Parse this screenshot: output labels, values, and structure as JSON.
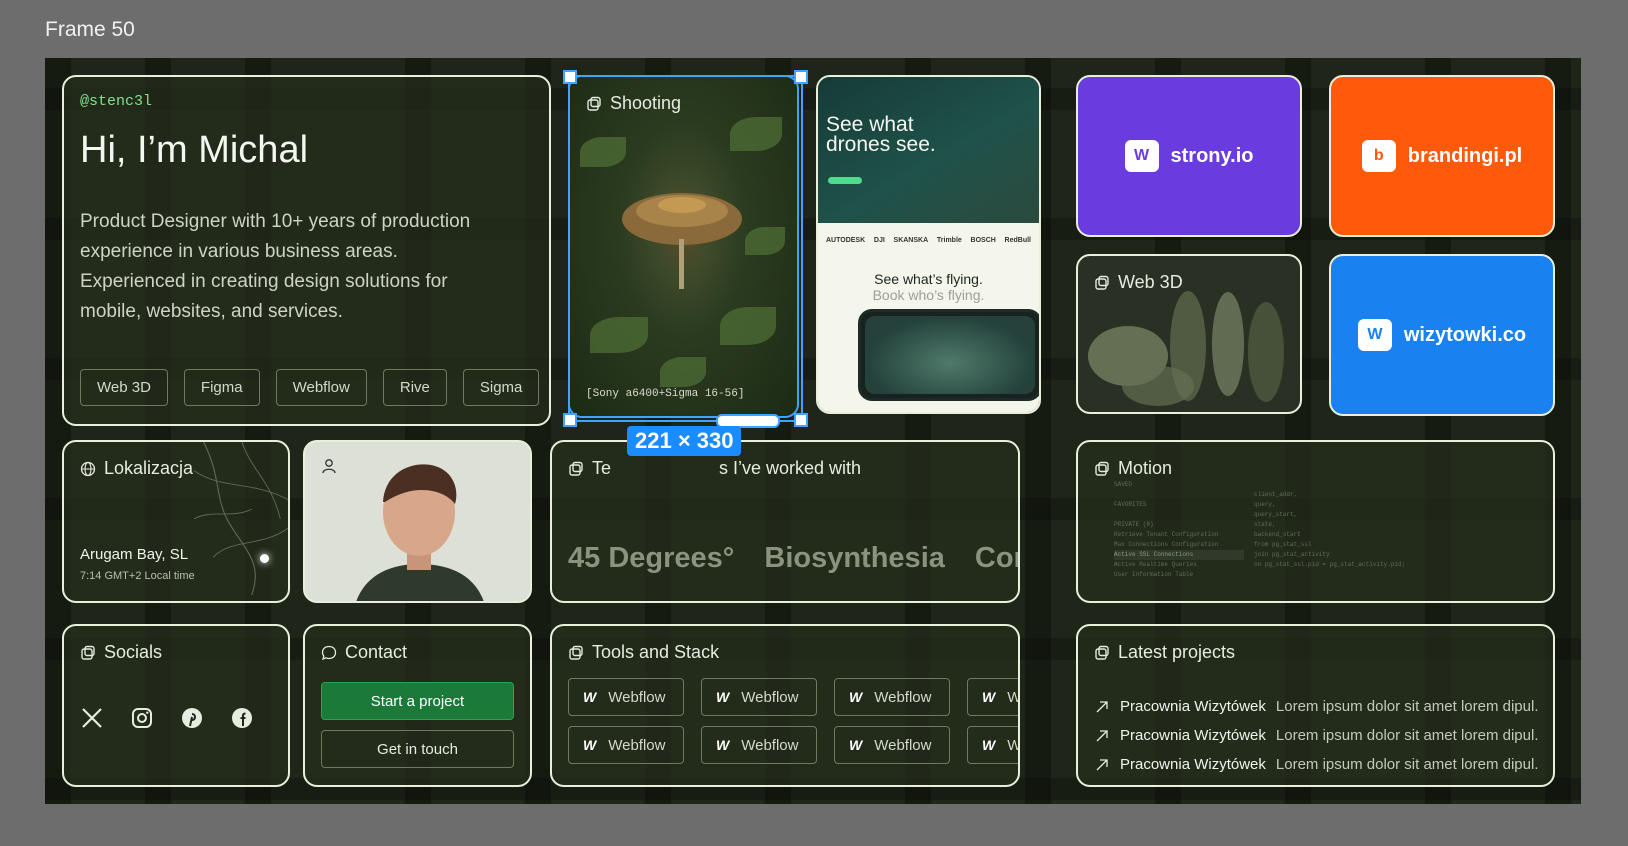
{
  "frame_label": "Frame 50",
  "intro": {
    "handle": "@stenc3l",
    "title": "Hi, I’m Michal",
    "description": "Product Designer with 10+ years of production experience in various business areas. Experienced in creating design solutions for mobile, websites, and services.",
    "tags": [
      "Web 3D",
      "Figma",
      "Webflow",
      "Rive",
      "Sigma"
    ]
  },
  "shooting": {
    "title": "Shooting",
    "caption": "[Sony a6400+Sigma 16-56]"
  },
  "selection": {
    "dimensions": "221 × 330"
  },
  "drones": {
    "headline": "See what drones see.",
    "logos": [
      "AUTODESK",
      "DJI",
      "SKANSKA",
      "Trimble",
      "BOSCH",
      "RedBull"
    ],
    "tagline": "See what’s flying.",
    "subtagline": "Book who’s flying."
  },
  "brands": {
    "strony": {
      "name": "strony.io",
      "color": "#6a3ce0"
    },
    "brandingi": {
      "name": "brandingi.pl",
      "color": "#ff5a0a"
    },
    "wizytowki": {
      "name": "wizytowki.co",
      "color": "#1a82f0"
    }
  },
  "web3d": {
    "title": "Web 3D"
  },
  "location": {
    "title": "Lokalizacja",
    "place": "Arugam Bay, SL",
    "time": "7:14 GMT+2 Local time"
  },
  "clients": {
    "title_start": "Te",
    "title_end": "s I’ve worked with",
    "names": [
      "45 Degrees°",
      "Biosynthesia",
      "Cont"
    ]
  },
  "motion": {
    "title": "Motion",
    "code_lines": [
      "SAVED",
      "FAVORITES",
      "PRIVATE (8)",
      "Retrieve Tenant Configuration",
      "Max Connections Configuration",
      "Active SSL Connections",
      "Active Realtime Queries",
      "User Information Table"
    ],
    "sql": [
      "client_addr,",
      "query,",
      "query_start,",
      "state,",
      "backend_start",
      "from pg_stat_ssl",
      "join pg_stat_activity",
      "on pg_stat_ssl.pid = pg_stat_activity.pid;"
    ]
  },
  "socials": {
    "title": "Socials",
    "icons": [
      "x-icon",
      "instagram-icon",
      "pinterest-icon",
      "facebook-icon"
    ]
  },
  "contact": {
    "title": "Contact",
    "primary_label": "Start a project",
    "secondary_label": "Get in touch"
  },
  "tools": {
    "title": "Tools and Stack",
    "items": [
      "Webflow",
      "Webflow",
      "Webflow",
      "W",
      "Webflow",
      "Webflow",
      "Webflow",
      "W"
    ]
  },
  "projects": {
    "title": "Latest projects",
    "items": [
      {
        "name": "Pracownia Wizytówek",
        "desc": "Lorem ipsum dolor sit amet lorem dipul."
      },
      {
        "name": "Pracownia Wizytówek",
        "desc": "Lorem ipsum dolor sit amet lorem dipul."
      },
      {
        "name": "Pracownia Wizytówek",
        "desc": "Lorem ipsum dolor sit amet lorem dipul."
      }
    ]
  }
}
